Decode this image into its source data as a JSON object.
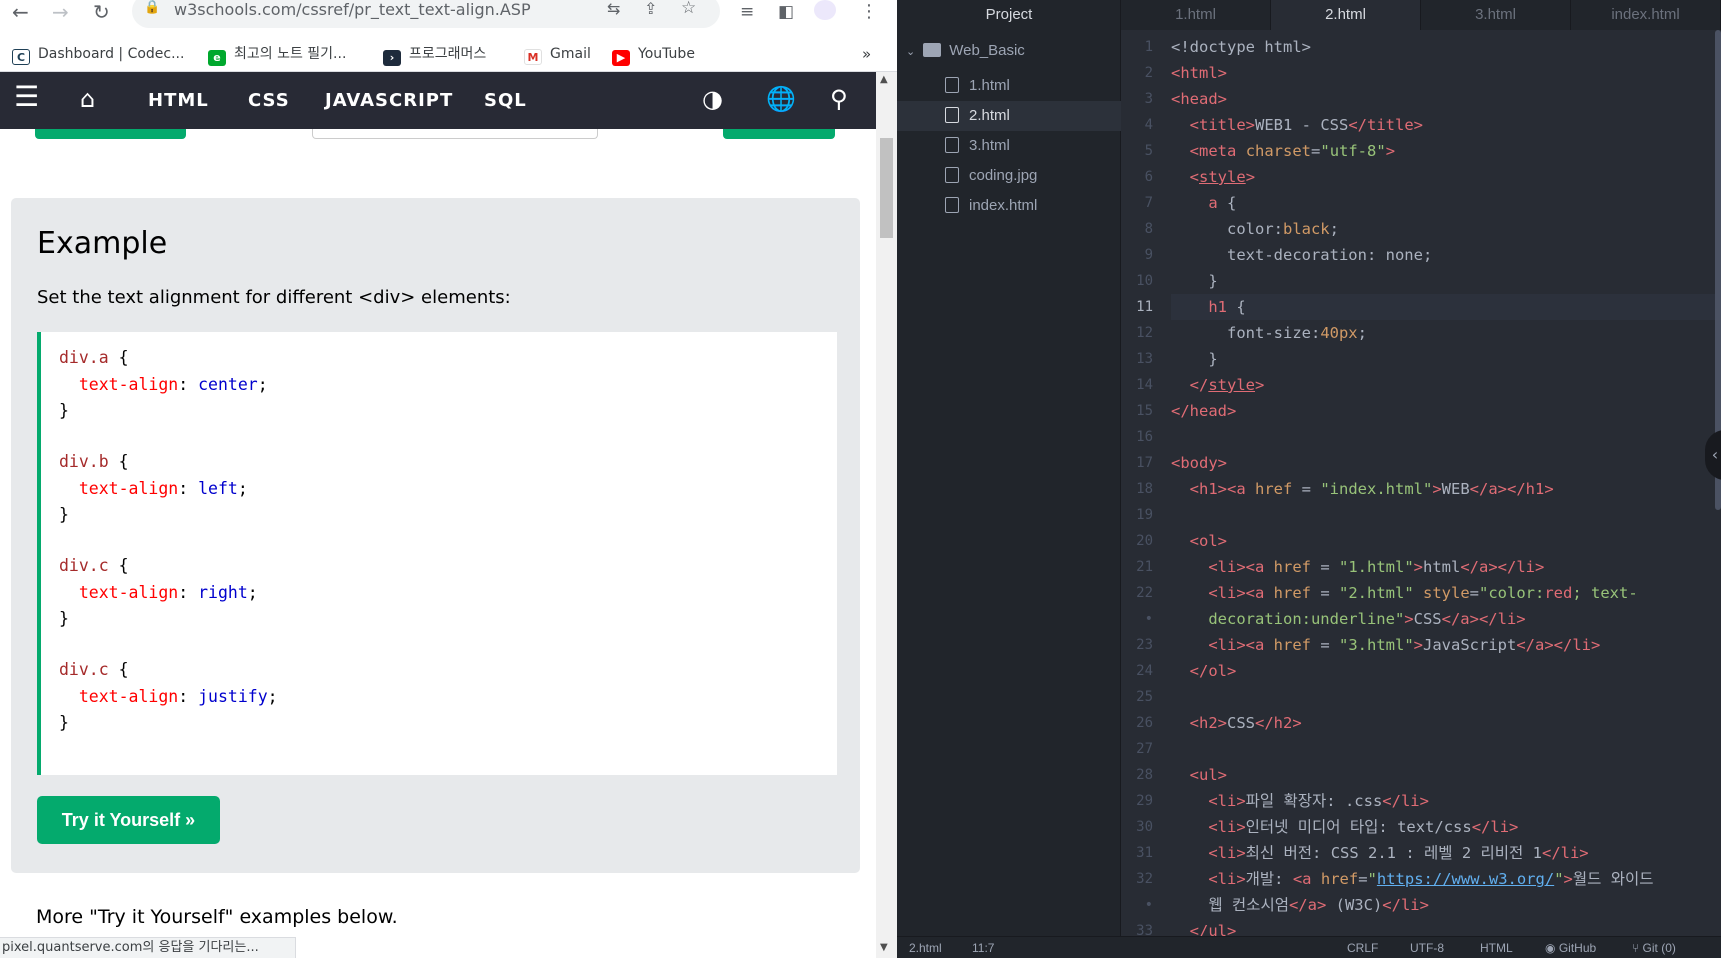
{
  "browser": {
    "url": "w3schools.com/cssref/pr_text_text-align.ASP",
    "bookmarks": [
      {
        "label": "Dashboard | Codec...",
        "icon": "codecademy-icon"
      },
      {
        "label": "최고의 노트 필기...",
        "icon": "evernote-icon"
      },
      {
        "label": "프로그래머스",
        "icon": "programmers-icon"
      },
      {
        "label": "Gmail",
        "icon": "gmail-icon"
      },
      {
        "label": "YouTube",
        "icon": "youtube-icon"
      }
    ],
    "bookmarks_more": "»",
    "status": "pixel.quantserve.com의 응답을 기다리는..."
  },
  "w3": {
    "nav": [
      "HTML",
      "CSS",
      "JAVASCRIPT",
      "SQL"
    ],
    "example_title": "Example",
    "example_desc": "Set the text alignment for different <div> elements:",
    "code": [
      {
        "sel": "div.a",
        "prop": "text-align",
        "val": "center"
      },
      {
        "sel": "div.b",
        "prop": "text-align",
        "val": "left"
      },
      {
        "sel": "div.c",
        "prop": "text-align",
        "val": "right"
      },
      {
        "sel": "div.c",
        "prop": "text-align",
        "val": "justify"
      }
    ],
    "try_button": "Try it Yourself »",
    "more_text": "More \"Try it Yourself\" examples below."
  },
  "editor": {
    "tree_title": "Project",
    "folder": "Web_Basic",
    "files": [
      "1.html",
      "2.html",
      "3.html",
      "coding.jpg",
      "index.html"
    ],
    "selected_file": "2.html",
    "tabs": [
      "1.html",
      "2.html",
      "3.html",
      "index.html"
    ],
    "active_tab": "2.html",
    "status": {
      "file": "2.html",
      "cursor": "11:7",
      "eol": "CRLF",
      "encoding": "UTF-8",
      "grammar": "HTML",
      "github": "GitHub",
      "git": "Git (0)"
    },
    "line_numbers": [
      "1",
      "2",
      "3",
      "4",
      "5",
      "6",
      "7",
      "8",
      "9",
      "10",
      "11",
      "12",
      "13",
      "14",
      "15",
      "16",
      "17",
      "18",
      "19",
      "20",
      "21",
      "22",
      "•",
      "23",
      "24",
      "25",
      "26",
      "27",
      "28",
      "29",
      "30",
      "31",
      "32",
      "•",
      "33"
    ]
  }
}
